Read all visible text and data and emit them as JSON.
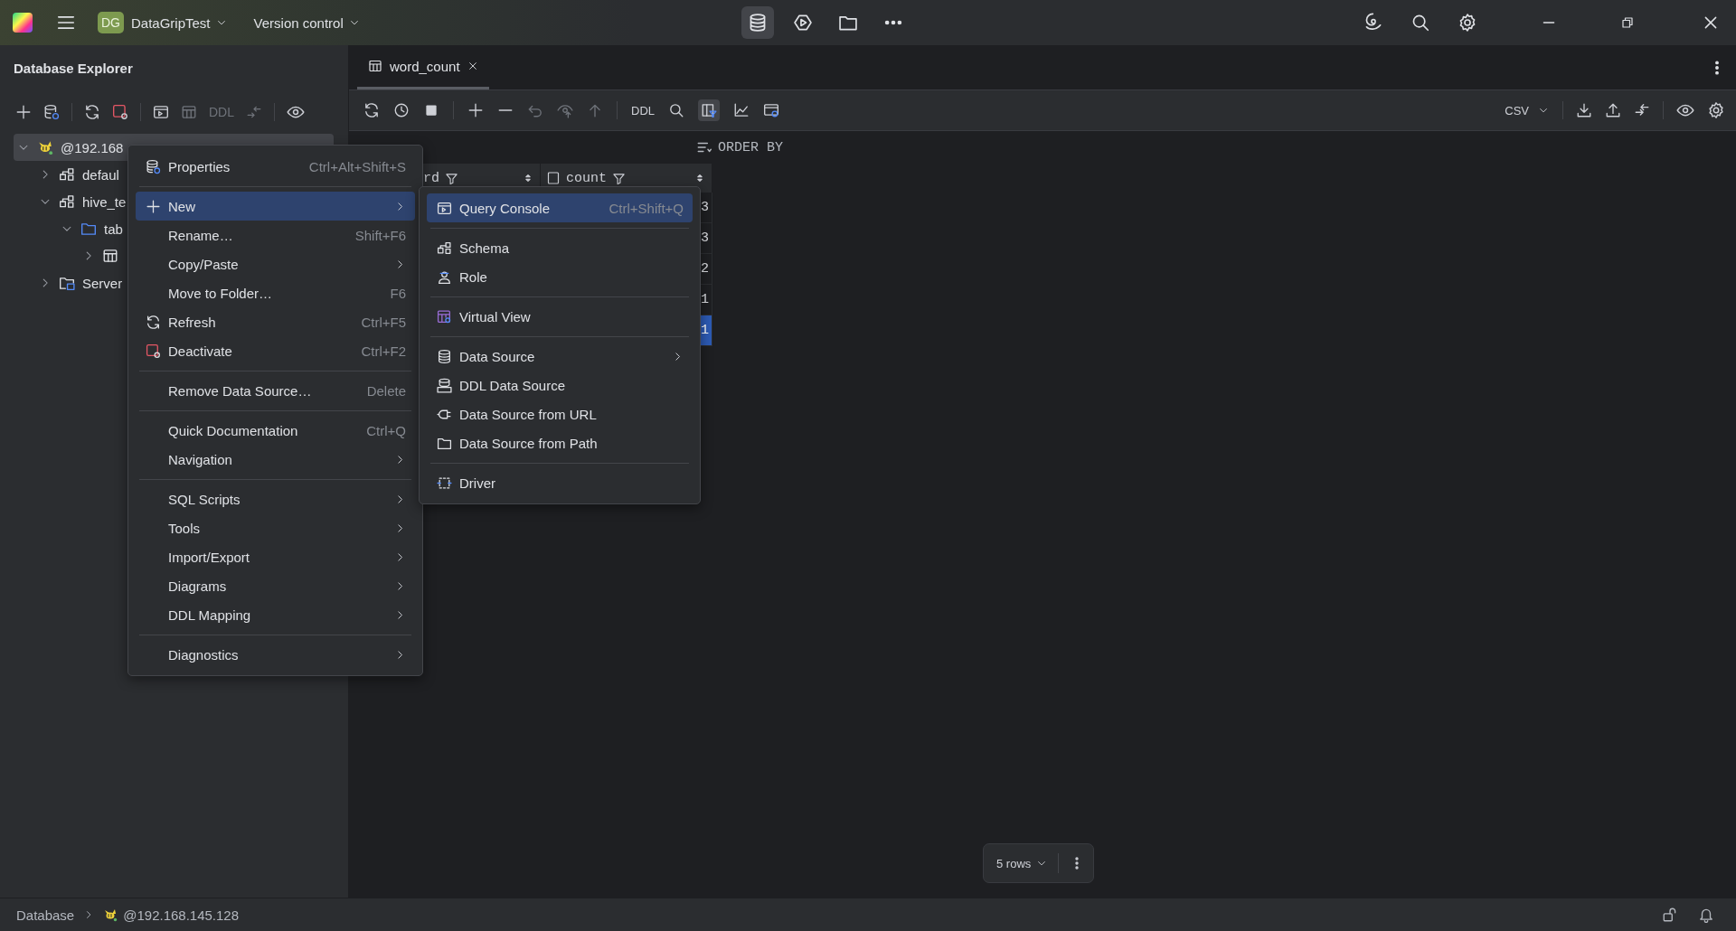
{
  "title_bar": {
    "project_badge": "DG",
    "project": "DataGripTest",
    "vcs": "Version control"
  },
  "explorer": {
    "title": "Database Explorer",
    "toolbar_label": "DDL",
    "tree": [
      {
        "label": "@192.168",
        "kind": "datasource",
        "expanded": true,
        "selected": true,
        "children": [
          {
            "label": "defaul",
            "kind": "schema",
            "expanded": false,
            "selected": false
          },
          {
            "label": "hive_te",
            "kind": "schema",
            "expanded": true,
            "selected": false,
            "children": [
              {
                "label": "tab",
                "kind": "folder",
                "expanded": true,
                "selected": false,
                "children": [
                  {
                    "kind": "table",
                    "expanded": false,
                    "selected": false
                  }
                ]
              }
            ]
          },
          {
            "label": "Server",
            "kind": "server",
            "expanded": false,
            "selected": false
          }
        ]
      }
    ]
  },
  "editor": {
    "tabs": [
      {
        "label": "word_count",
        "selected": true
      }
    ],
    "toolbar_label": "DDL",
    "export_format": "CSV",
    "order_by": "ORDER BY",
    "grid": {
      "columns": [
        "rd",
        "count"
      ],
      "rows": [
        {
          "value": "3",
          "selected": false
        },
        {
          "value": "3",
          "selected": false
        },
        {
          "value": "2",
          "selected": false
        },
        {
          "value": "1",
          "selected": false
        },
        {
          "value": "1",
          "selected": true
        }
      ]
    },
    "page_size": "5 rows"
  },
  "context_menu": {
    "items": [
      {
        "kind": "item",
        "label": "Properties",
        "shortcut": "Ctrl+Alt+Shift+S",
        "submenu": false,
        "selected": false
      },
      {
        "kind": "separator"
      },
      {
        "kind": "item",
        "label": "New",
        "submenu": true,
        "selected": true
      },
      {
        "kind": "item",
        "label": "Rename…",
        "shortcut": "Shift+F6",
        "submenu": false,
        "selected": false
      },
      {
        "kind": "item",
        "label": "Copy/Paste",
        "submenu": true,
        "selected": false
      },
      {
        "kind": "item",
        "label": "Move to Folder…",
        "shortcut": "F6",
        "submenu": false,
        "selected": false
      },
      {
        "kind": "item",
        "label": "Refresh",
        "shortcut": "Ctrl+F5",
        "submenu": false,
        "selected": false
      },
      {
        "kind": "item",
        "label": "Deactivate",
        "shortcut": "Ctrl+F2",
        "submenu": false,
        "selected": false
      },
      {
        "kind": "separator"
      },
      {
        "kind": "item",
        "label": "Remove Data Source…",
        "shortcut": "Delete",
        "submenu": false,
        "selected": false
      },
      {
        "kind": "separator"
      },
      {
        "kind": "item",
        "label": "Quick Documentation",
        "shortcut": "Ctrl+Q",
        "submenu": false,
        "selected": false
      },
      {
        "kind": "item",
        "label": "Navigation",
        "submenu": true,
        "selected": false
      },
      {
        "kind": "separator"
      },
      {
        "kind": "item",
        "label": "SQL Scripts",
        "submenu": true,
        "selected": false
      },
      {
        "kind": "item",
        "label": "Tools",
        "submenu": true,
        "selected": false
      },
      {
        "kind": "item",
        "label": "Import/Export",
        "submenu": true,
        "selected": false
      },
      {
        "kind": "item",
        "label": "Diagrams",
        "submenu": true,
        "selected": false
      },
      {
        "kind": "item",
        "label": "DDL Mapping",
        "submenu": true,
        "selected": false
      },
      {
        "kind": "separator"
      },
      {
        "kind": "item",
        "label": "Diagnostics",
        "submenu": true,
        "selected": false
      }
    ]
  },
  "new_submenu": {
    "items": [
      {
        "kind": "item",
        "label": "Query Console",
        "shortcut": "Ctrl+Shift+Q",
        "submenu": false,
        "selected": true
      },
      {
        "kind": "separator"
      },
      {
        "kind": "item",
        "label": "Schema",
        "submenu": false,
        "selected": false
      },
      {
        "kind": "item",
        "label": "Role",
        "submenu": false,
        "selected": false
      },
      {
        "kind": "separator"
      },
      {
        "kind": "item",
        "label": "Virtual View",
        "submenu": false,
        "selected": false
      },
      {
        "kind": "separator"
      },
      {
        "kind": "item",
        "label": "Data Source",
        "submenu": true,
        "selected": false
      },
      {
        "kind": "item",
        "label": "DDL Data Source",
        "submenu": false,
        "selected": false
      },
      {
        "kind": "item",
        "label": "Data Source from URL",
        "submenu": false,
        "selected": false
      },
      {
        "kind": "item",
        "label": "Data Source from Path",
        "submenu": false,
        "selected": false
      },
      {
        "kind": "separator"
      },
      {
        "kind": "item",
        "label": "Driver",
        "submenu": false,
        "selected": false
      }
    ]
  },
  "status_bar": {
    "breadcrumbs": [
      "Database",
      "@192.168.145.128"
    ]
  }
}
